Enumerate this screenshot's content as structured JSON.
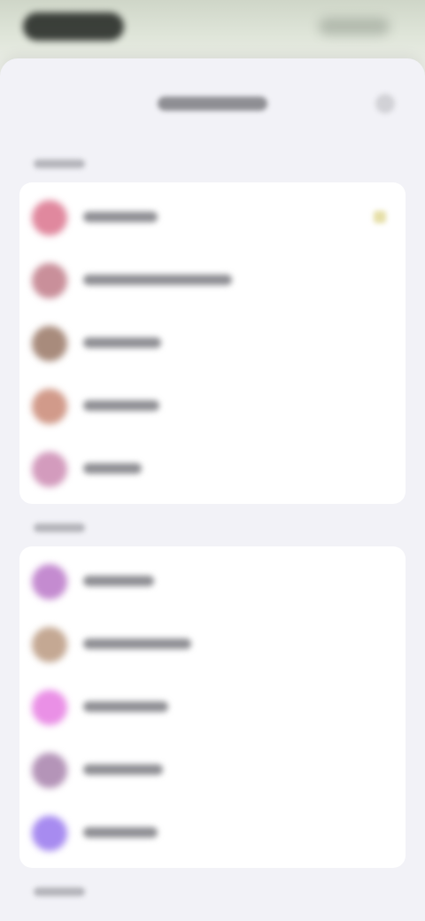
{
  "header": {
    "title": "",
    "close_icon": "close-icon"
  },
  "sections": [
    {
      "header": "",
      "items": [
        {
          "label": "",
          "avatar_color": "#e0889e",
          "selected": true
        },
        {
          "label": "",
          "avatar_color": "#c98f9a",
          "selected": false
        },
        {
          "label": "",
          "avatar_color": "#a88b7c",
          "selected": false
        },
        {
          "label": "",
          "avatar_color": "#d19a8a",
          "selected": false
        },
        {
          "label": "",
          "avatar_color": "#d39bbd",
          "selected": false
        }
      ]
    },
    {
      "header": "",
      "items": [
        {
          "label": "",
          "avatar_color": "#c48bd0",
          "selected": false
        },
        {
          "label": "",
          "avatar_color": "#c4a893",
          "selected": false
        },
        {
          "label": "",
          "avatar_color": "#ea90e6",
          "selected": false
        },
        {
          "label": "",
          "avatar_color": "#b494b8",
          "selected": false
        },
        {
          "label": "",
          "avatar_color": "#a78bf0",
          "selected": false
        }
      ]
    },
    {
      "header": "",
      "items": []
    }
  ]
}
